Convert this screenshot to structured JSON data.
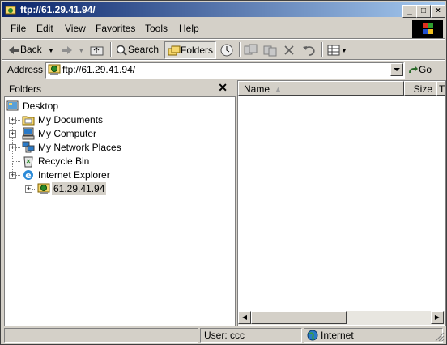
{
  "window": {
    "title": "ftp://61.29.41.94/"
  },
  "menu": [
    "File",
    "Edit",
    "View",
    "Favorites",
    "Tools",
    "Help"
  ],
  "toolbar": {
    "back": "Back",
    "search": "Search",
    "folders": "Folders"
  },
  "address": {
    "label": "Address",
    "value": "ftp://61.29.41.94/",
    "go": "Go"
  },
  "folders_pane": {
    "title": "Folders",
    "items": [
      {
        "label": "Desktop",
        "icon": "desktop-icon"
      },
      {
        "label": "My Documents",
        "icon": "folder-icon"
      },
      {
        "label": "My Computer",
        "icon": "computer-icon"
      },
      {
        "label": "My Network Places",
        "icon": "network-icon"
      },
      {
        "label": "Recycle Bin",
        "icon": "recycle-bin-icon"
      },
      {
        "label": "Internet Explorer",
        "icon": "ie-icon"
      },
      {
        "label": "61.29.41.94",
        "icon": "ftp-site-icon"
      }
    ]
  },
  "file_list": {
    "columns": [
      "Name",
      "Size",
      "T"
    ]
  },
  "status": {
    "user": "User: ccc",
    "zone": "Internet"
  },
  "colors": {
    "title_start": "#0a246a",
    "title_end": "#a6caf0",
    "chrome": "#d4d0c8"
  }
}
